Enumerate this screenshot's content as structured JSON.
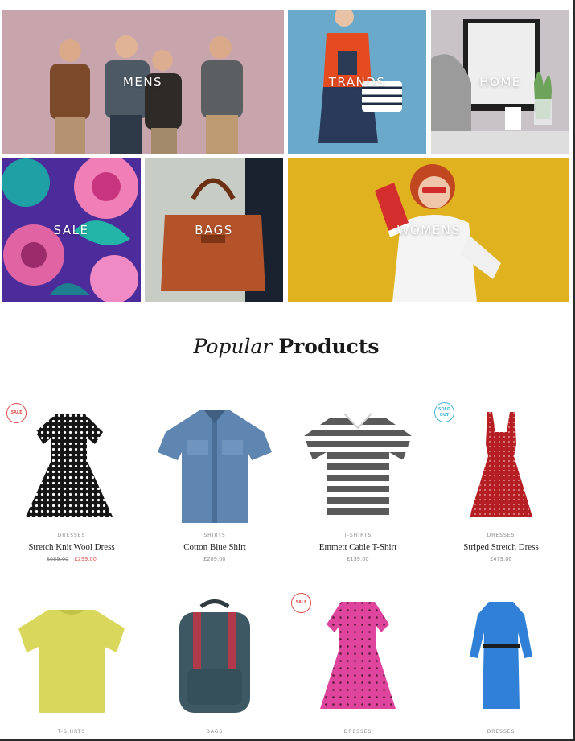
{
  "banners": [
    {
      "label": "MENS",
      "bg": "#c8a5ad"
    },
    {
      "label": "TRANDS",
      "bg": "#6aa9c9"
    },
    {
      "label": "HOME",
      "bg": "#c9c3c8"
    },
    {
      "label": "SALE",
      "bg": "#4b2c9a"
    },
    {
      "label": "BAGS",
      "bg": "#c7ccc4"
    },
    {
      "label": "WOMENS",
      "bg": "#e0b21f"
    }
  ],
  "section": {
    "title_italic": "Popular",
    "title_bold": "Products"
  },
  "products": [
    {
      "category": "DRESSES",
      "name": "Stretch Knit Wool Dress",
      "old_price": "£689.00",
      "price": "£299.00",
      "badge": "SALE",
      "icon": "polka-dot-dress"
    },
    {
      "category": "SHIRTS",
      "name": "Cotton Blue Shirt",
      "price": "£209.00",
      "icon": "denim-shirt"
    },
    {
      "category": "T-SHIRTS",
      "name": "Emmett Cable T-Shirt",
      "price": "£139.00",
      "icon": "striped-tshirt"
    },
    {
      "category": "DRESSES",
      "name": "Striped Stretch Dress",
      "price": "£479.00",
      "badge": "SOLD OUT",
      "icon": "red-dress"
    },
    {
      "category": "T-SHIRTS",
      "icon": "yellow-tshirt"
    },
    {
      "category": "BAGS",
      "icon": "backpack"
    },
    {
      "category": "DRESSES",
      "badge": "SALE",
      "icon": "pink-dress"
    },
    {
      "category": "DRESSES",
      "icon": "blue-dress"
    }
  ],
  "colors": {
    "sale": "#e05050",
    "sold_out": "#4bb6d6"
  }
}
